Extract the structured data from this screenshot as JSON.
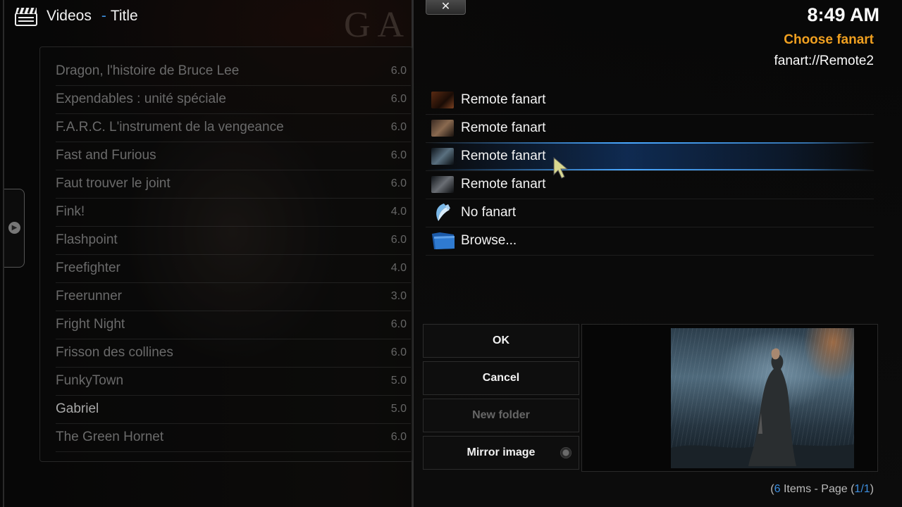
{
  "header": {
    "section": "Videos",
    "sort": "Title"
  },
  "background_title": "GA",
  "movies": [
    {
      "title": "Dragon, l'histoire de Bruce Lee",
      "rating": "6.0"
    },
    {
      "title": "Expendables : unité spéciale",
      "rating": "6.0"
    },
    {
      "title": "F.A.R.C. L'instrument de la vengeance",
      "rating": "6.0"
    },
    {
      "title": "Fast and Furious",
      "rating": "6.0"
    },
    {
      "title": "Faut trouver le joint",
      "rating": "6.0"
    },
    {
      "title": "Fink!",
      "rating": "4.0"
    },
    {
      "title": "Flashpoint",
      "rating": "6.0"
    },
    {
      "title": "Freefighter",
      "rating": "4.0"
    },
    {
      "title": "Freerunner",
      "rating": "3.0"
    },
    {
      "title": "Fright Night",
      "rating": "6.0"
    },
    {
      "title": "Frisson des collines",
      "rating": "6.0"
    },
    {
      "title": "FunkyTown",
      "rating": "5.0"
    },
    {
      "title": "Gabriel",
      "rating": "5.0"
    },
    {
      "title": "The Green Hornet",
      "rating": "6.0"
    }
  ],
  "close_label": "✕",
  "clock": "8:49 AM",
  "dialog": {
    "title": "Choose fanart",
    "current": "fanart://Remote2",
    "options": [
      {
        "label": "Remote fanart",
        "icon": "remote-fanart-thumbnail"
      },
      {
        "label": "Remote fanart",
        "icon": "remote-fanart-thumbnail"
      },
      {
        "label": "Remote fanart",
        "icon": "remote-fanart-thumbnail"
      },
      {
        "label": "Remote fanart",
        "icon": "remote-fanart-thumbnail"
      },
      {
        "label": "No fanart",
        "icon": "no-fanart-icon"
      },
      {
        "label": "Browse...",
        "icon": "folder-icon"
      }
    ],
    "selected_index": 2,
    "buttons": {
      "ok": "OK",
      "cancel": "Cancel",
      "new_folder": "New folder",
      "mirror": "Mirror image"
    },
    "mirror_image_checked": false
  },
  "footer": {
    "count": "6",
    "items_text": " Items - Page (",
    "page": "1/1",
    "open_paren": "(",
    "close_paren": ")"
  },
  "colors": {
    "accent_blue": "#3d8fe0",
    "title_orange": "#f0a020"
  }
}
